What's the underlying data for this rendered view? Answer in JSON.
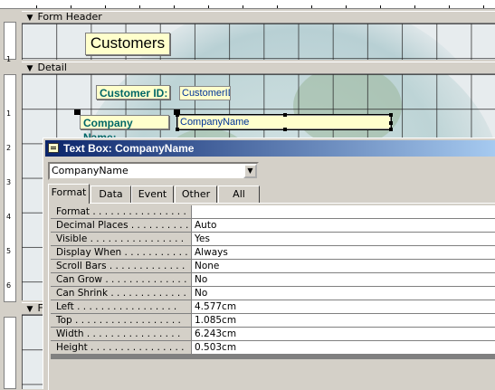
{
  "form": {
    "header_section": "Form Header",
    "detail_section": "Detail",
    "footer_section": "F",
    "title_label": "Customers",
    "controls": [
      {
        "label": "Customer ID:",
        "field": "CustomerID"
      },
      {
        "label": "Company Name:",
        "field": "CompanyName"
      }
    ]
  },
  "ruler_numbers": [
    "1",
    "1",
    "2",
    "3",
    "4",
    "5",
    "6"
  ],
  "property_sheet": {
    "title": "Text Box: CompanyName",
    "selected_object": "CompanyName",
    "tabs": [
      "Format",
      "Data",
      "Event",
      "Other",
      "All"
    ],
    "active_tab": "Format",
    "properties": [
      {
        "name": "Format . . . . . . . . . . . . . . . .",
        "value": ""
      },
      {
        "name": "Decimal Places . . . . . . . . . . .",
        "value": "Auto"
      },
      {
        "name": "Visible . . . . . . . . . . . . . . . .",
        "value": "Yes"
      },
      {
        "name": "Display When . . . . . . . . . . .",
        "value": "Always"
      },
      {
        "name": "Scroll Bars . . . . . . . . . . . . .",
        "value": "None"
      },
      {
        "name": "Can Grow . . . . . . . . . . . . . .",
        "value": "No"
      },
      {
        "name": "Can Shrink . . . . . . . . . . . . .",
        "value": "No"
      },
      {
        "name": "Left . . . . . . . . . . . . . . . . .",
        "value": "4.577cm"
      },
      {
        "name": "Top . . . . . . . . . . . . . . . . . .",
        "value": "1.085cm"
      },
      {
        "name": "Width . . . . . . . . . . . . . . . .",
        "value": "6.243cm"
      },
      {
        "name": "Height . . . . . . . . . . . . . . . .",
        "value": "0.503cm"
      }
    ]
  },
  "colors": {
    "label_text": "#006666",
    "field_text": "#003399",
    "label_bg": "#ffffcc",
    "title_bar": "#0a246a"
  }
}
